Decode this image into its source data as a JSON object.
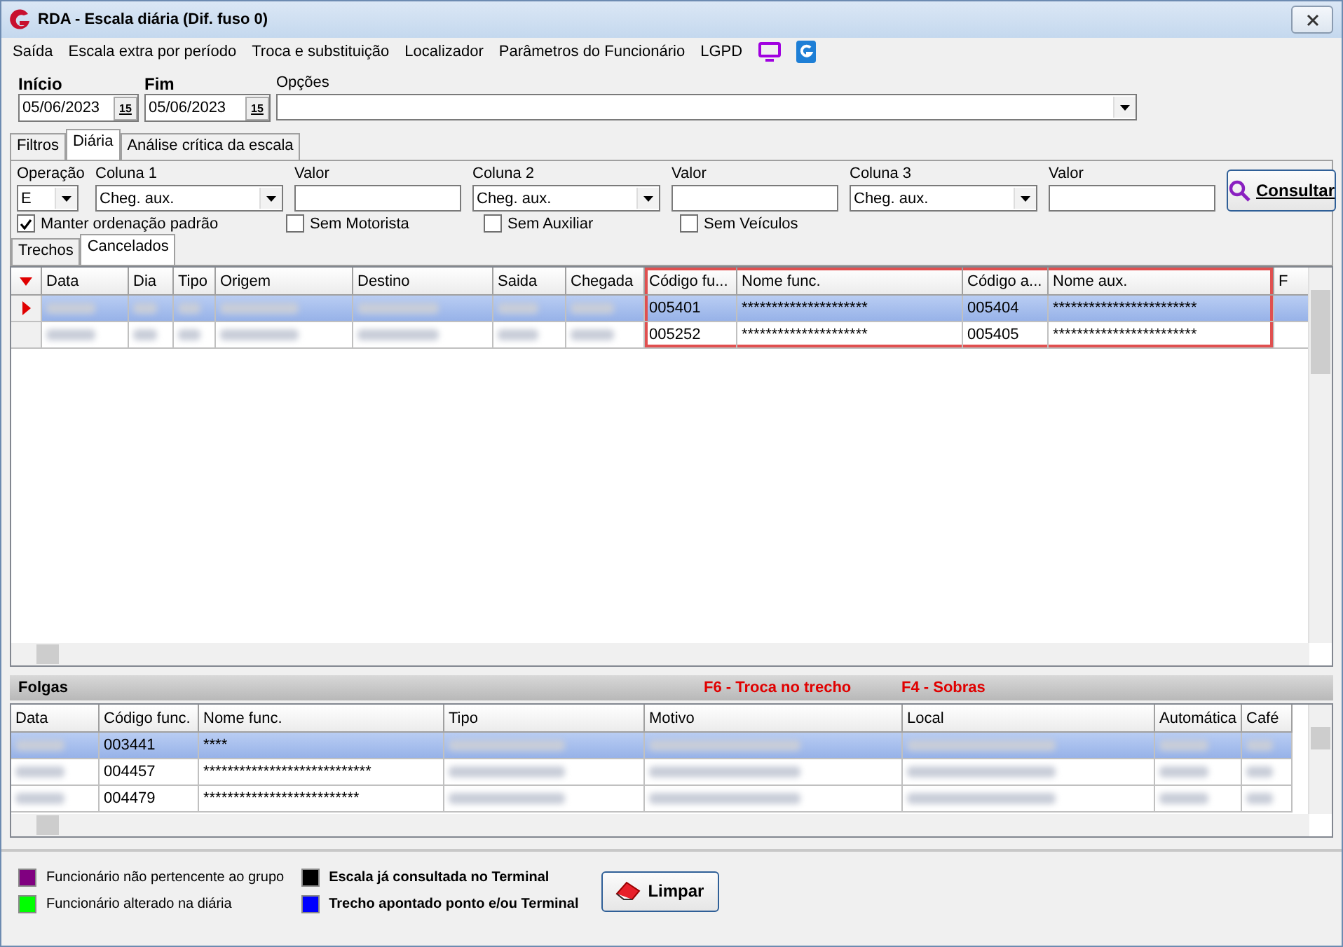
{
  "window": {
    "title": "RDA - Escala diária (Dif. fuso 0)"
  },
  "menu": [
    "Saída",
    "Escala extra por período",
    "Troca e substituição",
    "Localizador",
    "Parâmetros do Funcionário",
    "LGPD"
  ],
  "dates": [
    {
      "label": "Início",
      "value": "05/06/2023",
      "calendar": "15"
    },
    {
      "label": "Fim",
      "value": "05/06/2023",
      "calendar": "15"
    }
  ],
  "options_label": "Opções",
  "tabs": [
    {
      "label": "Filtros",
      "selected": false
    },
    {
      "label": "Diária",
      "selected": true
    },
    {
      "label": "Análise crítica da escala",
      "selected": false
    }
  ],
  "filter": {
    "operation_label": "Operação",
    "operation_value": "E",
    "columns": [
      {
        "label": "Coluna 1",
        "value": "Cheg. aux.",
        "value_label": "Valor"
      },
      {
        "label": "Coluna 2",
        "value": "Cheg. aux.",
        "value_label": "Valor"
      },
      {
        "label": "Coluna 3",
        "value": "Cheg. aux.",
        "value_label": "Valor"
      }
    ],
    "checks": [
      {
        "label": "Manter ordenação padrão",
        "checked": true
      },
      {
        "label": "Sem Motorista",
        "checked": false
      },
      {
        "label": "Sem Auxiliar",
        "checked": false
      },
      {
        "label": "Sem Veículos",
        "checked": false
      }
    ],
    "button": "Consultar"
  },
  "subtabs": [
    {
      "label": "Trechos",
      "selected": false
    },
    {
      "label": "Cancelados",
      "selected": true
    }
  ],
  "grid": {
    "columns": [
      {
        "label": "Data",
        "highlighted": false
      },
      {
        "label": "Dia",
        "highlighted": false
      },
      {
        "label": "Tipo",
        "highlighted": false
      },
      {
        "label": "Origem",
        "highlighted": false
      },
      {
        "label": "Destino",
        "highlighted": false
      },
      {
        "label": "Saida",
        "highlighted": false
      },
      {
        "label": "Chegada",
        "highlighted": false
      },
      {
        "label": "Código fu...",
        "highlighted": true
      },
      {
        "label": "Nome func.",
        "highlighted": true
      },
      {
        "label": "Código a...",
        "highlighted": true
      },
      {
        "label": "Nome aux.",
        "highlighted": true
      },
      {
        "label": "F",
        "highlighted": false
      }
    ],
    "rows": [
      {
        "selected": true,
        "cells": [
          null,
          null,
          null,
          null,
          null,
          null,
          null,
          "005401",
          "*********************",
          "005404",
          "************************"
        ]
      },
      {
        "selected": false,
        "cells": [
          null,
          null,
          null,
          null,
          null,
          null,
          null,
          "005252",
          "*********************",
          "005405",
          "************************"
        ]
      }
    ]
  },
  "folgas": {
    "title": "Folgas",
    "hints": [
      "F6 - Troca no trecho",
      "F4 - Sobras"
    ],
    "columns": [
      "Data",
      "Código func.",
      "Nome func.",
      "Tipo",
      "Motivo",
      "Local",
      "Automática",
      "Café"
    ],
    "rows": [
      {
        "selected": true,
        "cells": [
          null,
          "003441",
          "****",
          null,
          null,
          null,
          null,
          null
        ]
      },
      {
        "selected": false,
        "cells": [
          null,
          "004457",
          "****************************",
          null,
          null,
          null,
          null,
          null
        ]
      },
      {
        "selected": false,
        "cells": [
          null,
          "004479",
          "**************************",
          null,
          null,
          null,
          null,
          null
        ]
      }
    ]
  },
  "legend": [
    {
      "label": "Funcionário não pertencente ao grupo",
      "color": "#800080",
      "bold": false
    },
    {
      "label": "Escala já consultada no Terminal",
      "color": "#000000",
      "bold": true
    },
    {
      "label": "Funcionário alterado na diária",
      "color": "#00ff00",
      "bold": false
    },
    {
      "label": "Trecho apontado ponto e/ou Terminal",
      "color": "#0000ff",
      "bold": true
    }
  ],
  "clear_button": "Limpar"
}
